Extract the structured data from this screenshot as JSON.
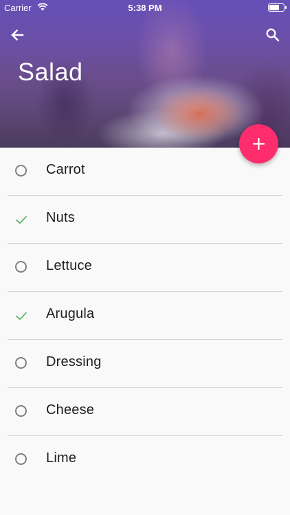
{
  "status_bar": {
    "carrier": "Carrier",
    "time": "5:38 PM"
  },
  "header": {
    "title": "Salad"
  },
  "colors": {
    "accent": "#ff2d6c",
    "check": "#4caf50",
    "radio": "#808080"
  },
  "items": [
    {
      "label": "Carrot",
      "checked": false
    },
    {
      "label": "Nuts",
      "checked": true
    },
    {
      "label": "Lettuce",
      "checked": false
    },
    {
      "label": "Arugula",
      "checked": true
    },
    {
      "label": "Dressing",
      "checked": false
    },
    {
      "label": "Cheese",
      "checked": false
    },
    {
      "label": "Lime",
      "checked": false
    }
  ]
}
